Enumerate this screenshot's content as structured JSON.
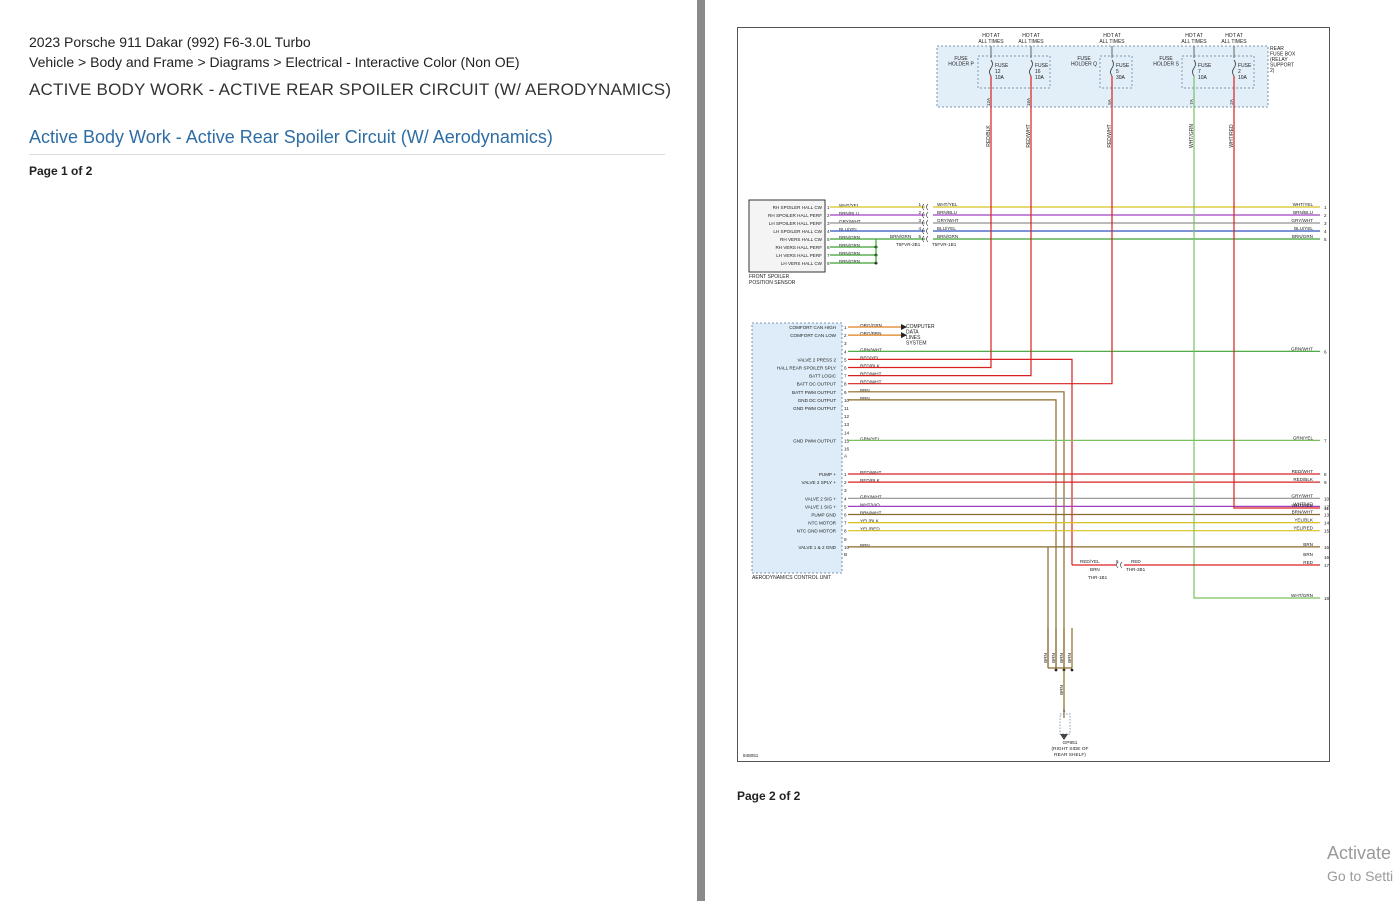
{
  "document": {
    "vehicle": "2023 Porsche 911 Dakar (992) F6-3.0L Turbo",
    "breadcrumb": "Vehicle > Body and Frame > Diagrams > Electrical - Interactive Color (Non OE)",
    "section_title": "ACTIVE BODY WORK - ACTIVE REAR SPOILER CIRCUIT (W/ AERODYNAMICS)",
    "link_title": "Active Body Work - Active Rear Spoiler Circuit (W/ Aerodynamics)",
    "page1": "Page 1 of 2",
    "page2": "Page 2 of 2"
  },
  "watermark": {
    "line1": "Activate",
    "line2": "Go to Setti"
  },
  "diagram": {
    "fuse_box": {
      "hot_labels": [
        "HOT AT ALL TIMES",
        "HOT AT ALL TIMES",
        "HOT AT ALL TIMES",
        "HOT AT ALL TIMES",
        "HOT AT ALL TIMES"
      ],
      "holders": [
        "FUSE HOLDER P",
        "FUSE HOLDER Q",
        "FUSE HOLDER S"
      ],
      "box_name": "REAR FUSE BOX (RELAY SUPPORT 2)",
      "fuses": [
        {
          "name": "FUSE 12 10A",
          "pin": "12A",
          "wire": "RED/BLK"
        },
        {
          "name": "FUSE 16 10A",
          "pin": "16A",
          "wire": "RED/WHT"
        },
        {
          "name": "FUSE 5 30A",
          "pin": "5A",
          "wire": "RED/WHT"
        },
        {
          "name": "FUSE 7 10A",
          "pin": "7A",
          "wire": "WHT/GRN"
        },
        {
          "name": "FUSE 2 10A",
          "pin": "2A",
          "wire": "WHT/RED"
        }
      ]
    },
    "sensor": {
      "name": "FRONT SPOILER POSITION SENSOR",
      "pins": [
        {
          "label": "RH SPOILER HALL CW",
          "num": "1",
          "wire": "WHT/YEL"
        },
        {
          "label": "RH SPOILER HALL PERF",
          "num": "2",
          "wire": "BRN/BLU"
        },
        {
          "label": "LH SPOILER HALL PERF",
          "num": "3",
          "wire": "GRY/WHT"
        },
        {
          "label": "LH SPOILER HALL CW",
          "num": "4",
          "wire": "BLU/YEL"
        },
        {
          "label": "RH VERS HALL CW",
          "num": "5",
          "wire": "BRN/GRN"
        },
        {
          "label": "RH VERS HALL PERF",
          "num": "6",
          "wire": "BRN/GRN"
        },
        {
          "label": "LH VERS HALL PERF",
          "num": "7",
          "wire": "BRN/GRN"
        },
        {
          "label": "LH VERS HALL CW",
          "num": "8",
          "wire": "BRN/GRN"
        }
      ],
      "inline_connector": "T5FVR-2B1",
      "inline_connector2": "T5FVR-1B1",
      "inline_wire": "BRN/GRN",
      "inline_pin_nums": [
        "1",
        "2",
        "3",
        "4",
        "5"
      ]
    },
    "ecu": {
      "name": "AERODYNAMICS CONTROL UNIT",
      "computer_data": "COMPUTER DATA LINES SYSTEM",
      "pins_a": [
        {
          "label": "COMFORT CAN HIGH",
          "num": "1",
          "wire": "ORG/GRN"
        },
        {
          "label": "COMFORT CAN LOW",
          "num": "2",
          "wire": "ORG/BRN"
        },
        {
          "label": "",
          "num": "3",
          "wire": ""
        },
        {
          "label": "",
          "num": "4",
          "wire": "GRN/WHT"
        },
        {
          "label": "VALVE 2 PRESS 2",
          "num": "5",
          "wire": "RED/YEL"
        },
        {
          "label": "HALL REAR SPOILER SPLY",
          "num": "6",
          "wire": "RED/BLK"
        },
        {
          "label": "BATT LOGIC",
          "num": "7",
          "wire": "RED/WHT"
        },
        {
          "label": "BATT DC OUTPUT",
          "num": "8",
          "wire": "RED/WHT"
        },
        {
          "label": "BATT PWM OUTPUT",
          "num": "9",
          "wire": "BRN"
        },
        {
          "label": "GND DC OUTPUT",
          "num": "10",
          "wire": "BRN"
        },
        {
          "label": "GND PWM OUTPUT",
          "num": "11",
          "wire": ""
        },
        {
          "label": "",
          "num": "12",
          "wire": ""
        },
        {
          "label": "",
          "num": "13",
          "wire": ""
        },
        {
          "label": "",
          "num": "14",
          "wire": ""
        },
        {
          "label": "GND PWM OUTPUT",
          "num": "15",
          "wire": "GRN/YEL"
        },
        {
          "label": "",
          "num": "16",
          "wire": ""
        }
      ],
      "conn_a": "A",
      "pins_b": [
        {
          "label": "PUMP +",
          "num": "1",
          "wire": "RED/WHT"
        },
        {
          "label": "VALVE 2 SPLY +",
          "num": "2",
          "wire": "RED/BLK"
        },
        {
          "label": "",
          "num": "3",
          "wire": ""
        },
        {
          "label": "VALVE 2 SIG +",
          "num": "4",
          "wire": "GRY/WHT"
        },
        {
          "label": "VALVE 1 SIG +",
          "num": "5",
          "wire": "WHT/VIO"
        },
        {
          "label": "PUMP GND",
          "num": "6",
          "wire": "BRN/WHT"
        },
        {
          "label": "NTC MOTOR",
          "num": "7",
          "wire": "YEL/BLK"
        },
        {
          "label": "NTC GND MOTOR",
          "num": "8",
          "wire": "YEL/RED"
        },
        {
          "label": "",
          "num": "9",
          "wire": ""
        },
        {
          "label": "VALVE 1 & 2 GND",
          "num": "10",
          "wire": "BRN"
        }
      ],
      "conn_b": "B"
    },
    "right_outputs": [
      {
        "num": "1",
        "wire": "WHT/YEL"
      },
      {
        "num": "2",
        "wire": "BRN/BLU"
      },
      {
        "num": "3",
        "wire": "GRY/WHT"
      },
      {
        "num": "4",
        "wire": "BLU/YEL"
      },
      {
        "num": "5",
        "wire": "BRN/GRN"
      },
      {
        "num": "6",
        "wire": "GRN/WHT"
      },
      {
        "num": "7",
        "wire": "GRN/YEL"
      },
      {
        "num": "8",
        "wire": "RED/WHT"
      },
      {
        "num": "9",
        "wire": "RED/BLK"
      },
      {
        "num": "10",
        "wire": "GRY/WHT"
      },
      {
        "num": "11",
        "wire": "WHT/RED"
      },
      {
        "num": "12",
        "wire": "WHT/VIO"
      },
      {
        "num": "13",
        "wire": "BRN/WHT"
      },
      {
        "num": "14",
        "wire": "YEL/BLK"
      },
      {
        "num": "15",
        "wire": "YEL/RED"
      },
      {
        "num": "16",
        "wire": "BRN"
      },
      {
        "num": "17",
        "wire": "RED"
      },
      {
        "num": "18",
        "wire": "WHT/GRN"
      }
    ],
    "thr": {
      "wire_in": "RED/YEL",
      "wire_brn": "BRN",
      "wire_out": "RED",
      "pin": "6",
      "conn1": "THR-1B1",
      "conn2": "THR-2B1"
    },
    "ground": {
      "wires": [
        "BRN",
        "BRN",
        "BRN",
        "BRN"
      ],
      "pin": "1",
      "name": "GP851 (RIGHT SIDE OF REAR SHELF)"
    },
    "code": "848051",
    "colors": {
      "red": "#d92020",
      "brown": "#8a6a2a",
      "yellow": "#d8c020",
      "green": "#3aa030",
      "lightgreen": "#7ac060",
      "blue": "#3050c0",
      "violet": "#a040c0",
      "gray": "#909090",
      "orange": "#e08020",
      "fusebox_fill": "#e2eef8",
      "ecu_fill": "#ddecf8"
    }
  }
}
